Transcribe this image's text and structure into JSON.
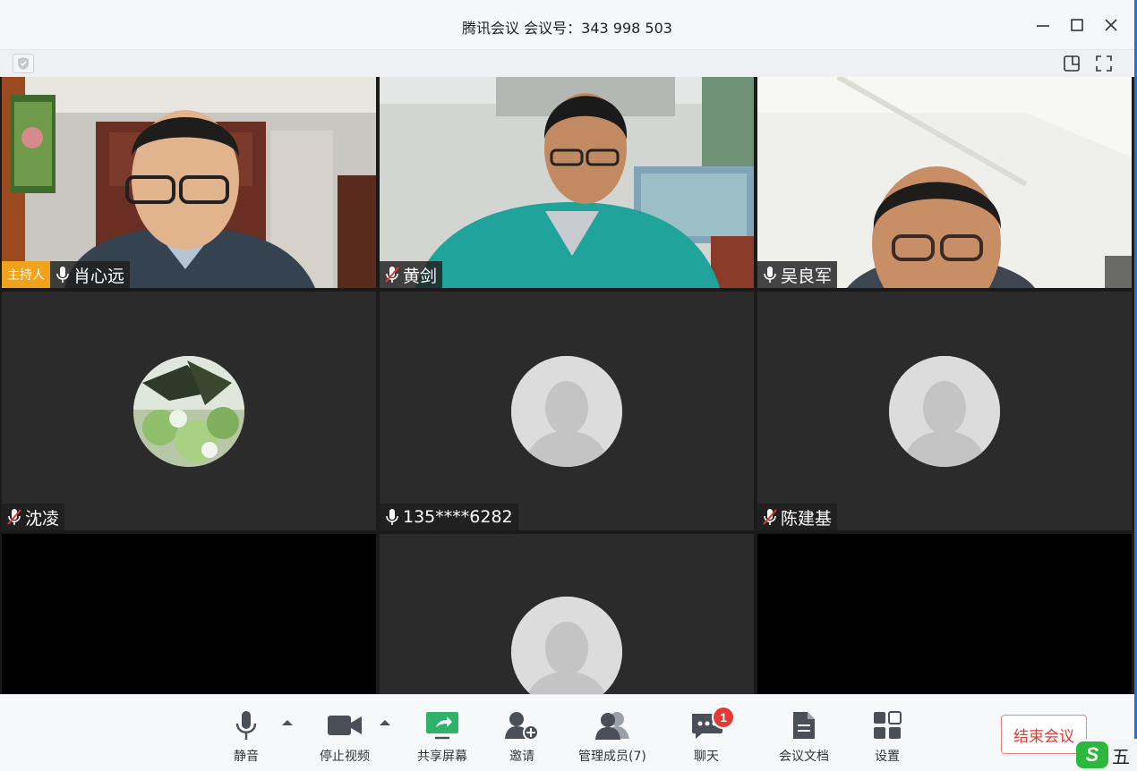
{
  "window": {
    "title": "腾讯会议 会议号：343 998 503"
  },
  "participants": [
    {
      "name": "肖心远",
      "host_label": "主持人",
      "mic": "on",
      "video": true
    },
    {
      "name": "黄剑",
      "mic": "muted",
      "video": true
    },
    {
      "name": "吴良军",
      "mic": "on",
      "video": true
    },
    {
      "name": "沈凌",
      "mic": "muted",
      "video": false,
      "avatar": "photo"
    },
    {
      "name": "135****6282",
      "mic": "on",
      "video": false,
      "avatar": "default"
    },
    {
      "name": "陈建基",
      "mic": "muted",
      "video": false,
      "avatar": "default"
    },
    {
      "name": "",
      "video": false,
      "avatar": "default"
    }
  ],
  "toolbar": {
    "mute_label": "静音",
    "stop_video_label": "停止视频",
    "share_screen_label": "共享屏幕",
    "invite_label": "邀请",
    "manage_members_label": "管理成员(7)",
    "chat_label": "聊天",
    "chat_badge": "1",
    "docs_label": "会议文档",
    "settings_label": "设置",
    "end_meeting_label": "结束会议"
  },
  "ime": {
    "logo": "S",
    "mode": "五"
  },
  "colors": {
    "host_tag": "#f0a21c",
    "share_green": "#2fb36b",
    "end_red": "#e53935",
    "badge_red": "#e53935"
  }
}
